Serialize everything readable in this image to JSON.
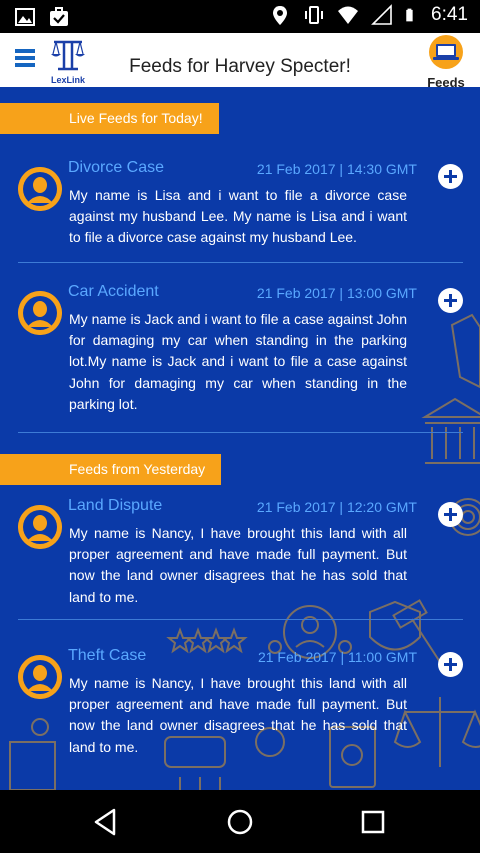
{
  "status_bar": {
    "time": "6:41",
    "icons": [
      "image-icon",
      "briefcase-check-icon",
      "location-icon",
      "vibrate-icon",
      "wifi-icon",
      "signal-icon",
      "battery-icon"
    ]
  },
  "header": {
    "logo_text": "LexLink",
    "title": "Feeds for Harvey Specter!",
    "feeds_tab_label": "Feeds"
  },
  "sections": [
    {
      "label": "Live Feeds for Today!",
      "items": [
        {
          "title": "Divorce Case",
          "date": "21 Feb 2017 | 14:30 GMT",
          "body": "My name is Lisa and i want to file a divorce case against my husband Lee. My name is Lisa and i want to file a divorce case against my husband Lee."
        },
        {
          "title": "Car Accident",
          "date": "21 Feb 2017 | 13:00 GMT",
          "body": "My name is Jack and i want to file a case against John for damaging my car when standing in the parking lot.My name is Jack and i want to file a case against John for damaging my car when standing in the parking lot."
        }
      ]
    },
    {
      "label": "Feeds from Yesterday",
      "items": [
        {
          "title": "Land Dispute",
          "date": "21 Feb 2017 | 12:20 GMT",
          "body": "My name is Nancy, I have brought this land with all proper agreement and have made full payment. But now the land owner disagrees that he has sold that land to me."
        },
        {
          "title": "Theft Case",
          "date": "21 Feb 2017 | 11:00 GMT",
          "body": "My name is Nancy, I have brought this land with all proper agreement and have made full payment. But now the land owner disagrees that he has sold that land to me."
        }
      ]
    }
  ],
  "colors": {
    "background": "#0b3aa8",
    "accent": "#f7a21a",
    "title_blue": "#5aa8ff"
  }
}
